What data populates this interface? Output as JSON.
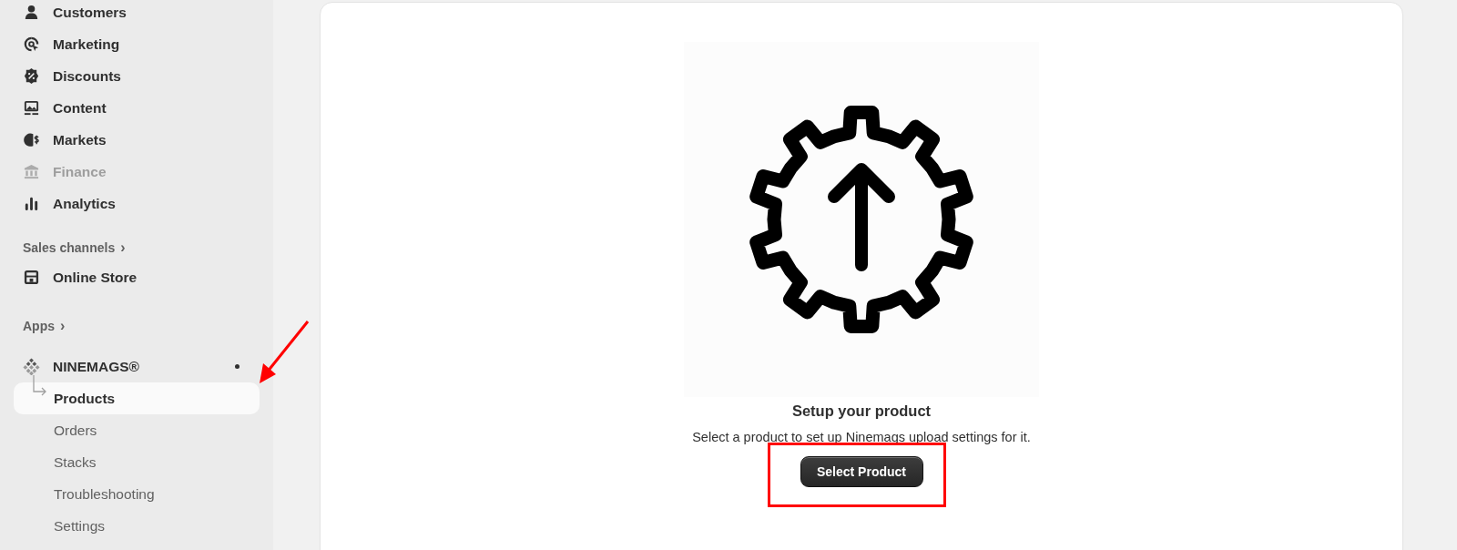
{
  "sidebar": {
    "items": [
      {
        "label": "Customers",
        "kind": "person",
        "disabled": false
      },
      {
        "label": "Marketing",
        "kind": "target",
        "disabled": false
      },
      {
        "label": "Discounts",
        "kind": "badge",
        "disabled": false
      },
      {
        "label": "Content",
        "kind": "image",
        "disabled": false
      },
      {
        "label": "Markets",
        "kind": "globe",
        "disabled": false
      },
      {
        "label": "Finance",
        "kind": "bank",
        "disabled": true
      },
      {
        "label": "Analytics",
        "kind": "bars",
        "disabled": false
      }
    ],
    "sales_channels": {
      "label": "Sales channels",
      "chevron": "›",
      "items": [
        {
          "label": "Online Store",
          "kind": "store"
        }
      ]
    },
    "apps": {
      "label": "Apps",
      "chevron": "›",
      "items": [
        {
          "label": "NINEMAGS®",
          "unread": true,
          "children": [
            {
              "label": "Products",
              "selected": true
            },
            {
              "label": "Orders",
              "selected": false
            },
            {
              "label": "Stacks",
              "selected": false
            },
            {
              "label": "Troubleshooting",
              "selected": false
            },
            {
              "label": "Settings",
              "selected": false
            }
          ]
        }
      ]
    }
  },
  "main": {
    "empty_state": {
      "title": "Setup your product",
      "description": "Select a product to set up Ninemags upload settings for it.",
      "button": "Select Product"
    }
  }
}
